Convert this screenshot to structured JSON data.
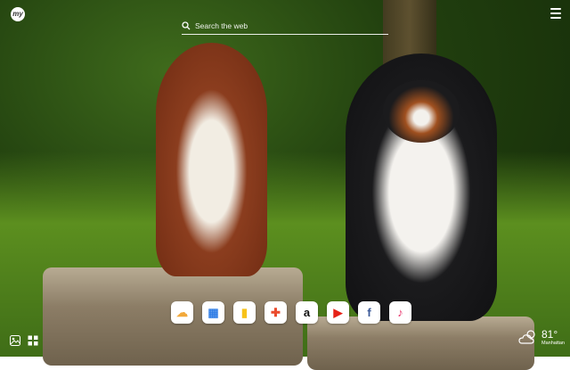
{
  "header": {
    "logo_text": "my"
  },
  "search": {
    "placeholder": "Search the web"
  },
  "dock": {
    "apps": [
      {
        "name": "weather-app-icon",
        "glyph": "☁",
        "color": "#f2a93b"
      },
      {
        "name": "apps-grid-icon",
        "glyph": "▦",
        "color": "#2c7be5"
      },
      {
        "name": "bookmark-app-icon",
        "glyph": "▮",
        "color": "#f7c21a"
      },
      {
        "name": "puzzle-app-icon",
        "glyph": "✚",
        "color": "#ea4a2c"
      },
      {
        "name": "amazon-icon",
        "glyph": "a",
        "color": "#111111"
      },
      {
        "name": "youtube-icon",
        "glyph": "▶",
        "color": "#e62117"
      },
      {
        "name": "facebook-icon",
        "glyph": "f",
        "color": "#3b5998"
      },
      {
        "name": "music-icon",
        "glyph": "♪",
        "color": "#e8356c"
      }
    ]
  },
  "weather": {
    "temperature": "81°",
    "city": "Manhattan",
    "icon": "partly-cloudy-icon"
  }
}
